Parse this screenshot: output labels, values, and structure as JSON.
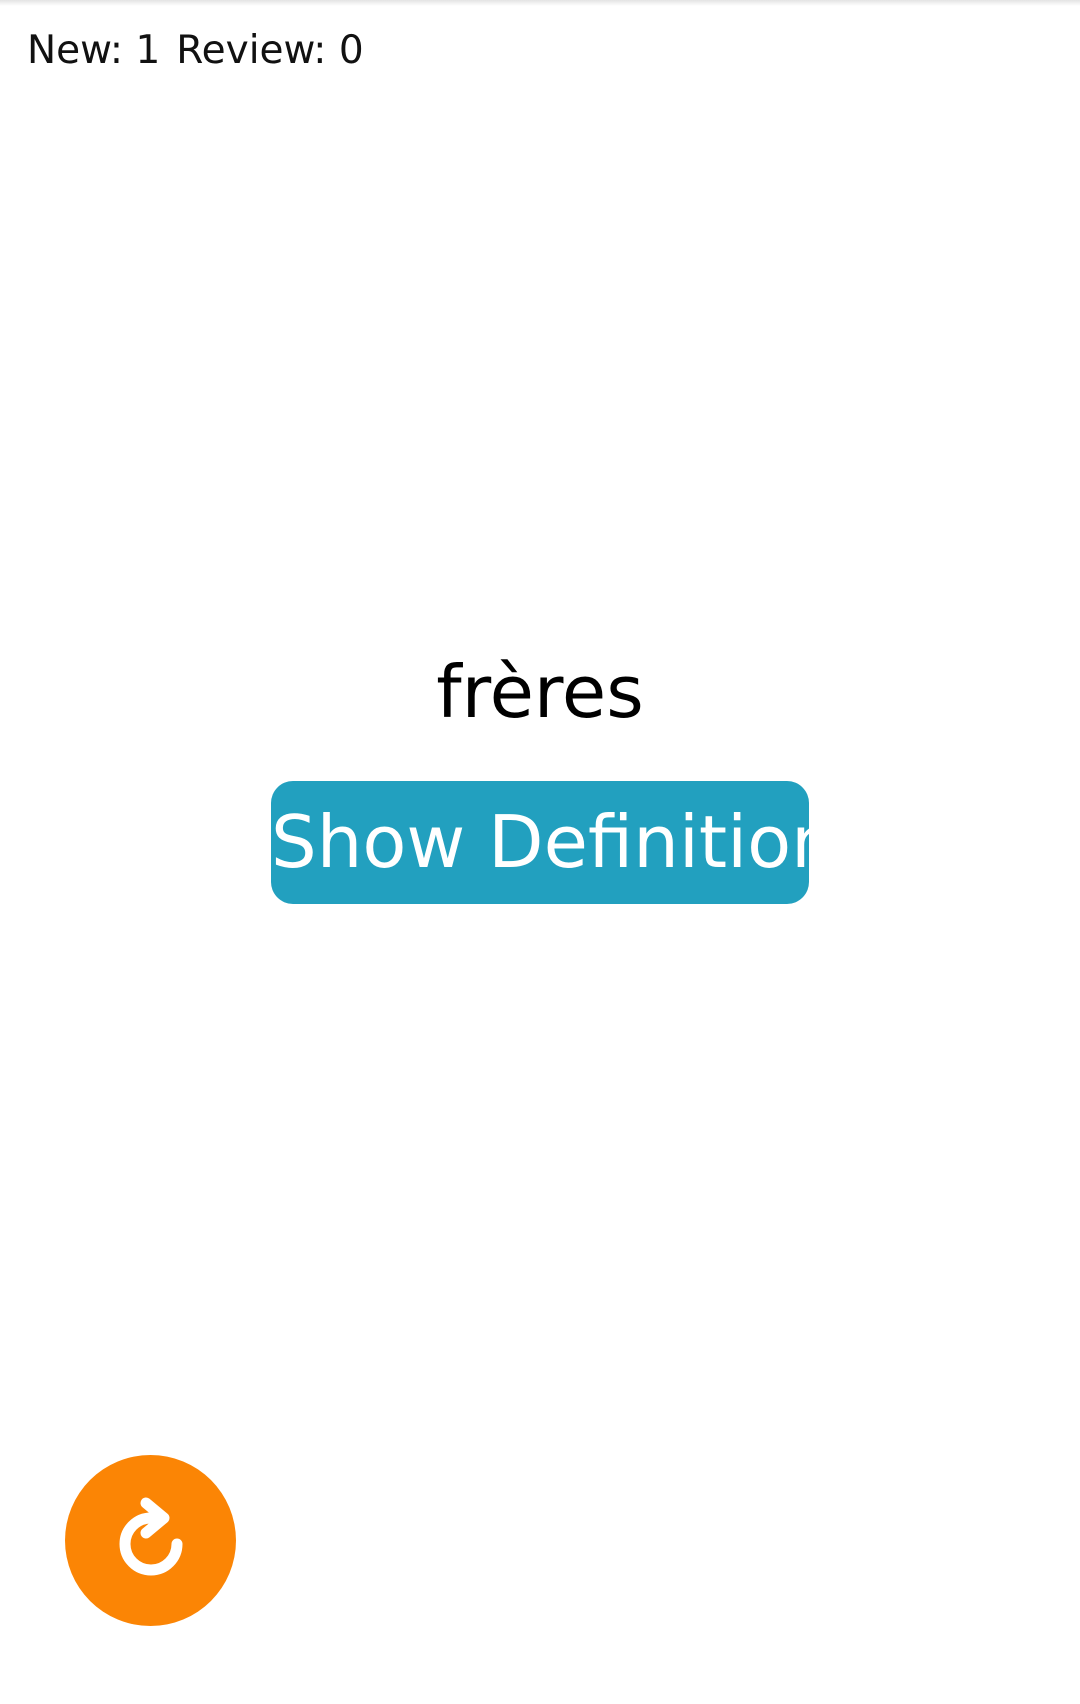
{
  "header": {
    "new_label": "New: 1",
    "review_label": "Review: 0"
  },
  "card": {
    "word": "frères",
    "show_button_label": "Show Definition"
  },
  "fab": {
    "icon": "refresh-icon"
  },
  "colors": {
    "button_bg": "#22a0bf",
    "fab_bg": "#fb8505",
    "text": "#000000"
  }
}
